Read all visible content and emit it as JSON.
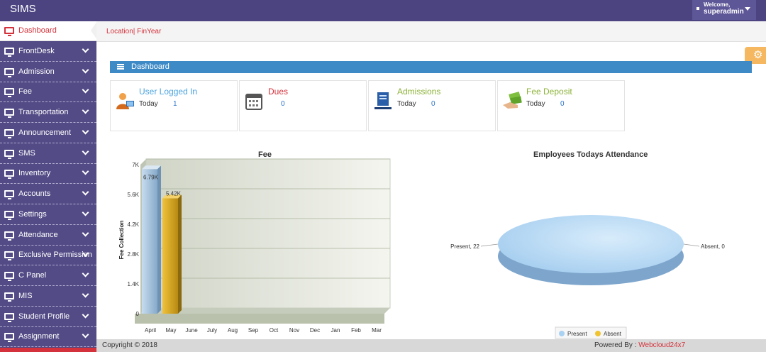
{
  "app": {
    "brand": "SIMS"
  },
  "user_menu": {
    "welcome_label": "Welcome,",
    "username": "superadmin"
  },
  "breadcrumb": {
    "text": "Location| FinYear"
  },
  "sidebar": {
    "items": [
      {
        "label": "Dashboard"
      },
      {
        "label": "FrontDesk"
      },
      {
        "label": "Admission"
      },
      {
        "label": "Fee"
      },
      {
        "label": "Transportation"
      },
      {
        "label": "Announcement"
      },
      {
        "label": "SMS"
      },
      {
        "label": "Inventory"
      },
      {
        "label": "Accounts"
      },
      {
        "label": "Settings"
      },
      {
        "label": "Attendance"
      },
      {
        "label": "Exclusive Permission"
      },
      {
        "label": "C Panel"
      },
      {
        "label": "MIS"
      },
      {
        "label": "Student Profile"
      },
      {
        "label": "Assignment"
      }
    ]
  },
  "dashboard": {
    "heading": "Dashboard",
    "stats": [
      {
        "title": "User Logged In",
        "period": "Today",
        "value": "1",
        "color": "#4aa3df",
        "icon": "user-icon"
      },
      {
        "title": "Dues",
        "period": "",
        "value": "0",
        "color": "#d3313b",
        "icon": "calendar-icon"
      },
      {
        "title": "Admissions",
        "period": "Today",
        "value": "0",
        "color": "#8db33a",
        "icon": "admissions-icon"
      },
      {
        "title": "Fee Deposit",
        "period": "Today",
        "value": "0",
        "color": "#8db33a",
        "icon": "money-icon"
      }
    ]
  },
  "chart_data": [
    {
      "type": "bar",
      "title": "Fee",
      "ylabel": "Fee Collection",
      "xlabel": "",
      "categories": [
        "April",
        "May",
        "June",
        "July",
        "Aug",
        "Sep",
        "Oct",
        "Nov",
        "Dec",
        "Jan",
        "Feb",
        "Mar"
      ],
      "values": [
        6790,
        5420,
        0,
        0,
        0,
        0,
        0,
        0,
        0,
        0,
        0,
        0
      ],
      "data_labels": [
        "6.79K",
        "5.42K",
        "",
        "",
        "",
        "",
        "",
        "",
        "",
        "",
        "",
        ""
      ],
      "bar_colors": [
        "#9dc0de",
        "#e1b42a"
      ],
      "ylim": [
        0,
        7000
      ],
      "yticks": [
        0,
        1400,
        2800,
        4200,
        5600,
        7000
      ],
      "ytick_labels": [
        "0",
        "1.4K",
        "2.8K",
        "4.2K",
        "5.6K",
        "7K"
      ],
      "grid": true
    },
    {
      "type": "pie",
      "title": "Employees Todays Attendance",
      "labels": [
        "Present",
        "Absent"
      ],
      "values": [
        22,
        0
      ],
      "slice_labels": [
        "Present, 22",
        "Absent, 0"
      ],
      "colors": [
        "#a9d1f2",
        "#f0c330"
      ],
      "legend": {
        "position": "bottom",
        "items": [
          "Present",
          "Absent"
        ]
      }
    }
  ],
  "footer": {
    "copyright": "Copyright © 2018",
    "powered_by": "Powered By : ",
    "vendor": "Webcloud24x7"
  }
}
